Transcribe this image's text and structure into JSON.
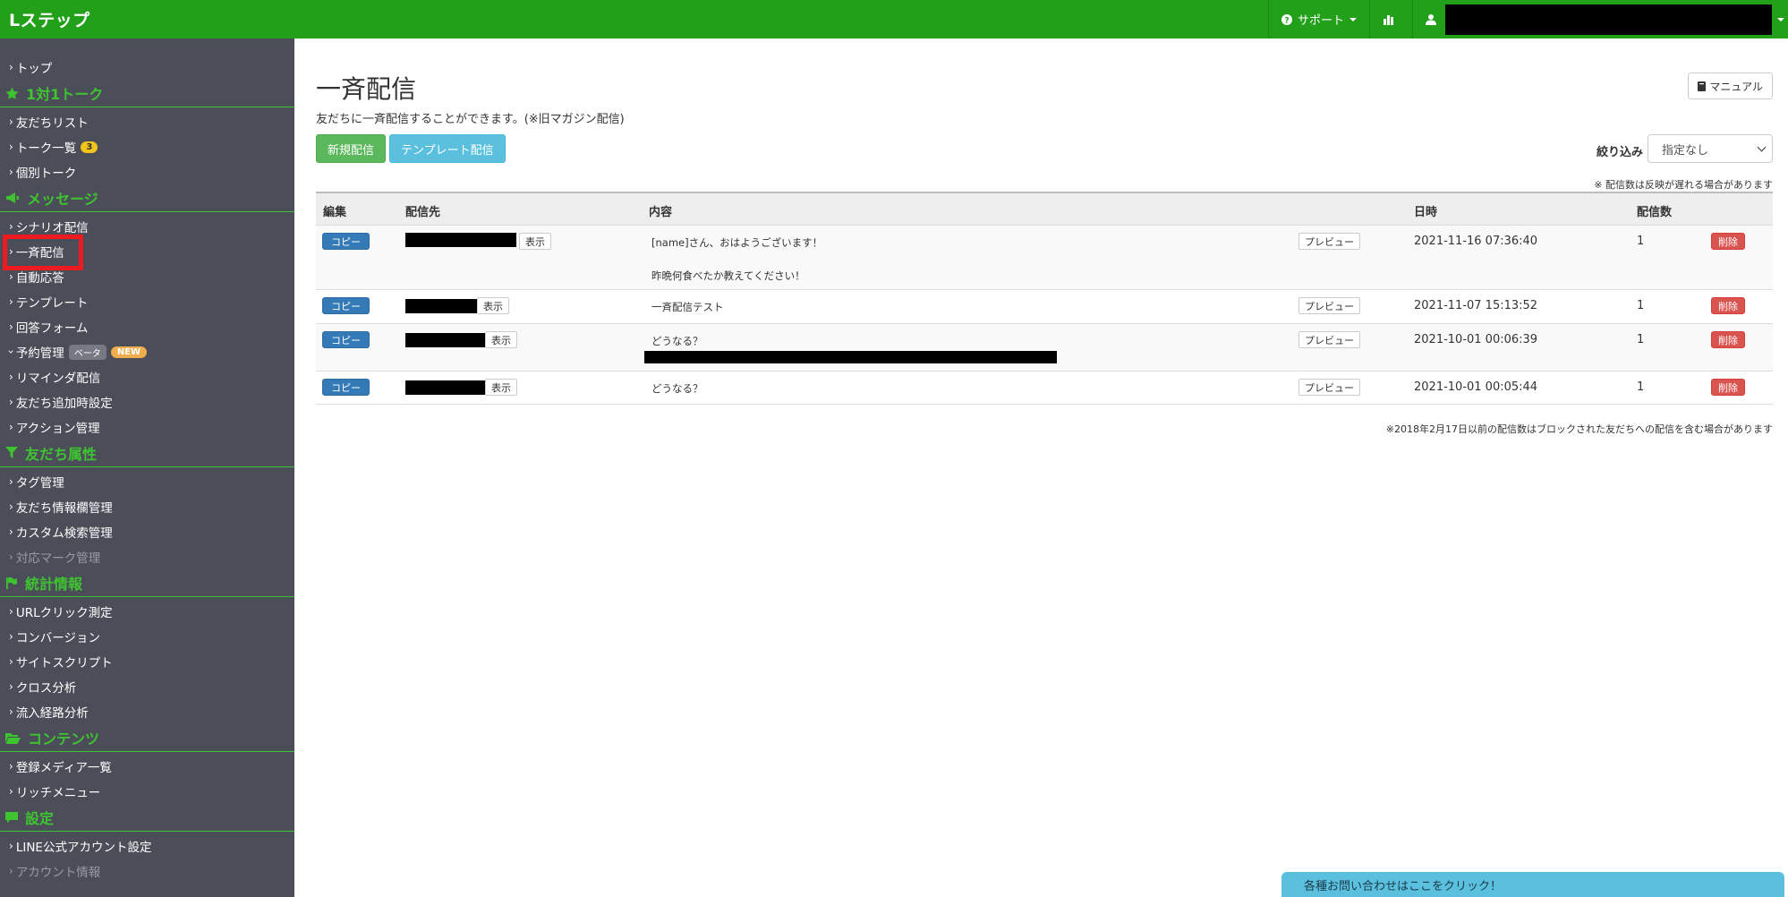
{
  "app": {
    "brand": "Lステップ"
  },
  "topbar": {
    "support_label": "サポート"
  },
  "sidebar": {
    "top": "トップ",
    "sections": [
      {
        "title": "1対1トーク",
        "icon": "star-icon",
        "items": [
          {
            "label": "友だちリスト"
          },
          {
            "label": "トーク一覧",
            "badge": "3"
          },
          {
            "label": "個別トーク"
          }
        ]
      },
      {
        "title": "メッセージ",
        "icon": "megaphone-icon",
        "items": [
          {
            "label": "シナリオ配信"
          },
          {
            "label": "一斉配信",
            "active": true
          },
          {
            "label": "自動応答"
          },
          {
            "label": "テンプレート"
          },
          {
            "label": "回答フォーム"
          },
          {
            "label": "予約管理",
            "beta": "ベータ",
            "new": "NEW"
          },
          {
            "label": "リマインダ配信"
          },
          {
            "label": "友だち追加時設定"
          },
          {
            "label": "アクション管理"
          }
        ]
      },
      {
        "title": "友だち属性",
        "icon": "filter-icon",
        "items": [
          {
            "label": "タグ管理"
          },
          {
            "label": "友だち情報欄管理"
          },
          {
            "label": "カスタム検索管理"
          },
          {
            "label": "対応マーク管理",
            "disabled": true
          }
        ]
      },
      {
        "title": "統計情報",
        "icon": "flag-icon",
        "items": [
          {
            "label": "URLクリック測定"
          },
          {
            "label": "コンバージョン"
          },
          {
            "label": "サイトスクリプト"
          },
          {
            "label": "クロス分析"
          },
          {
            "label": "流入経路分析"
          }
        ]
      },
      {
        "title": "コンテンツ",
        "icon": "folder-icon",
        "items": [
          {
            "label": "登録メディア一覧"
          },
          {
            "label": "リッチメニュー"
          }
        ]
      },
      {
        "title": "設定",
        "icon": "comment-icon",
        "items": [
          {
            "label": "LINE公式アカウント設定"
          },
          {
            "label": "アカウント情報",
            "disabled": true
          }
        ]
      }
    ]
  },
  "main": {
    "title": "一斉配信",
    "description": "友だちに一斉配信することができます。(※旧マガジン配信)",
    "manual_label": "マニュアル",
    "new_button": "新規配信",
    "template_button": "テンプレート配信",
    "filter_label": "絞り込み",
    "filter_value": "指定なし",
    "note_top": "※ 配信数は反映が遅れる場合があります",
    "note_bottom": "※2018年2月17日以前の配信数はブロックされた友だちへの配信を含む場合があります"
  },
  "table": {
    "headers": {
      "edit": "編集",
      "dest": "配信先",
      "content": "内容",
      "date": "日時",
      "count": "配信数"
    },
    "labels": {
      "copy": "コピー",
      "show": "表示",
      "preview": "プレビュー",
      "delete": "削除"
    },
    "rows": [
      {
        "line1": "[name]さん、おはようございます！",
        "line2": "昨晩何食べたか教えてください！",
        "date": "2021-11-16 07:36:40",
        "count": "1"
      },
      {
        "line1": "一斉配信テスト",
        "date": "2021-11-07 15:13:52",
        "count": "1"
      },
      {
        "line1": "どうなる？",
        "date": "2021-10-01 00:06:39",
        "count": "1"
      },
      {
        "line1": "どうなる？",
        "date": "2021-10-01 00:05:44",
        "count": "1"
      }
    ]
  },
  "contact": {
    "label": "各種お問い合わせはここをクリック！"
  }
}
